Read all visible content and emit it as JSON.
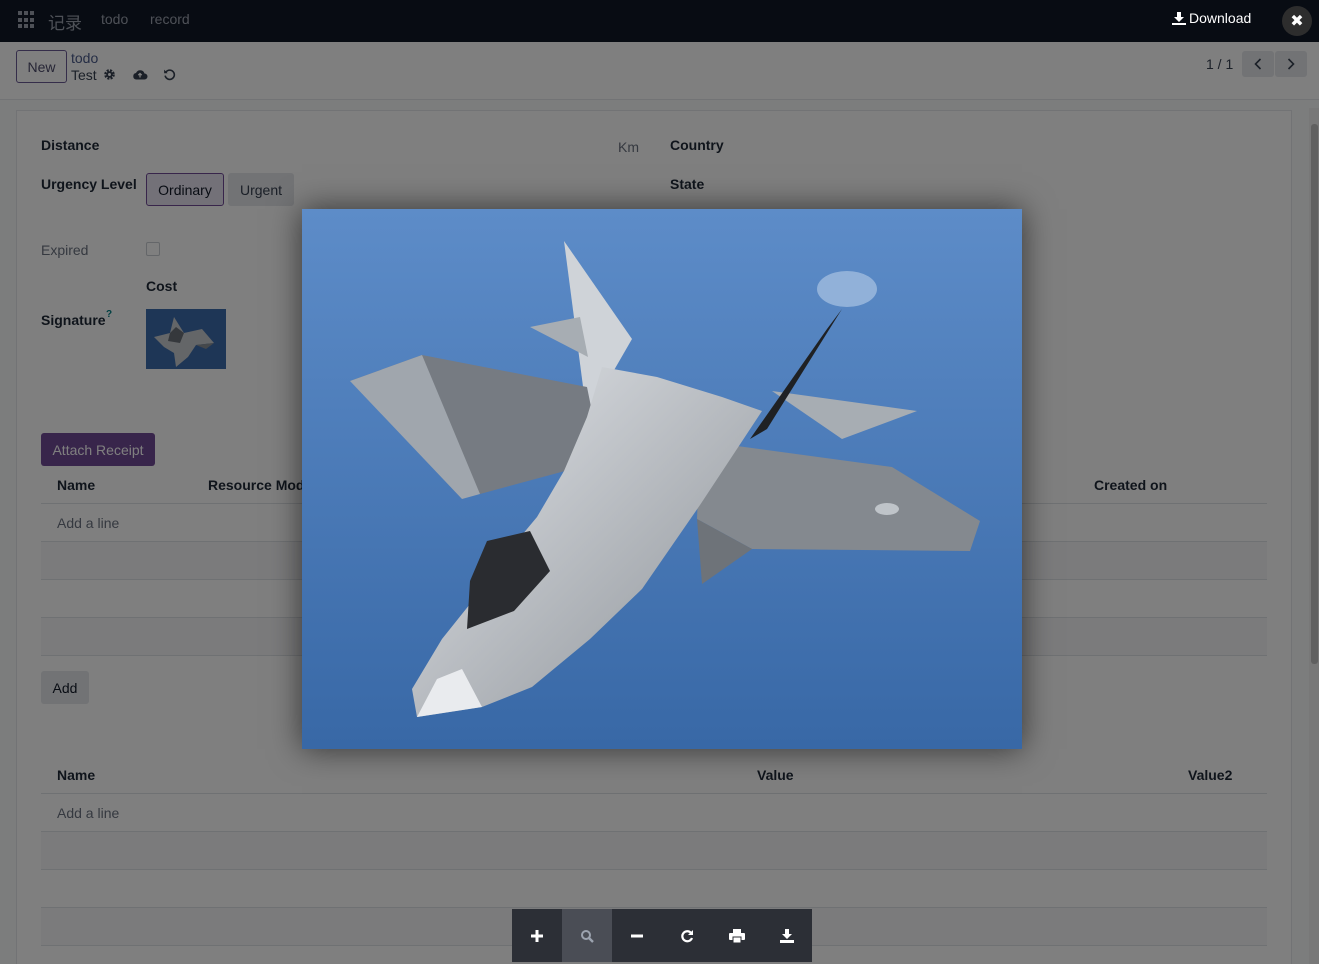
{
  "navbar": {
    "brand": "记录",
    "menu": [
      "todo",
      "record"
    ]
  },
  "control_panel": {
    "new_label": "New",
    "breadcrumb_parent": "todo",
    "breadcrumb_current": "Test",
    "pager": "1 / 1"
  },
  "form": {
    "distance_label": "Distance",
    "distance_unit": "Km",
    "country_label": "Country",
    "urgency_label": "Urgency Level",
    "urgency_options": [
      "Ordinary",
      "Urgent"
    ],
    "urgency_selected": "Ordinary",
    "state_label": "State",
    "expired_label": "Expired",
    "expired_checked": false,
    "cost_label": "Cost",
    "signature_label": "Signature",
    "signature_help": "?"
  },
  "receipts": {
    "attach_label": "Attach Receipt",
    "columns": [
      "Name",
      "Resource Mode",
      "Created on"
    ],
    "add_line": "Add a line"
  },
  "lines": {
    "add_label": "Add",
    "columns": [
      "Name",
      "Value",
      "Value2"
    ],
    "add_line": "Add a line"
  },
  "viewer": {
    "download_label": "Download",
    "close_icon": "close-icon",
    "tools": [
      "zoom-in-icon",
      "zoom-reset-icon",
      "zoom-out-icon",
      "rotate-icon",
      "print-icon",
      "download-icon"
    ]
  },
  "colors": {
    "navbar": "#111827",
    "primary": "#714b97",
    "toolbar": "#2c2f36"
  }
}
